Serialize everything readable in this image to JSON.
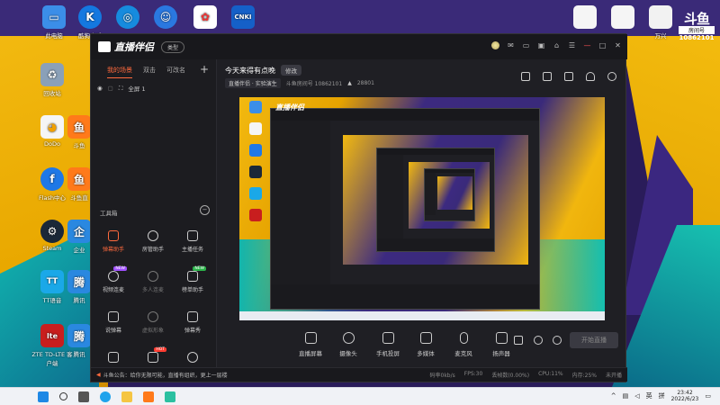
{
  "desktop": {
    "icons": [
      {
        "label": "此电脑",
        "color": "#3b8ee8",
        "glyph": "▭"
      },
      {
        "label": "酷狗音乐",
        "color": "#1478e0",
        "glyph": "K"
      },
      {
        "label": "",
        "color": "#168bde",
        "glyph": "◎"
      },
      {
        "label": "",
        "color": "#2a78e0",
        "glyph": "☺"
      },
      {
        "label": "",
        "color": "#ffffff",
        "glyph": "✿"
      },
      {
        "label": "CNKI",
        "color": "#1560c8",
        "glyph": "C"
      },
      {
        "label": "回收站",
        "color": "#8aa0b8",
        "glyph": "🗑"
      },
      {
        "label": "DoDo",
        "color": "#f5f5f5",
        "glyph": "🐥"
      },
      {
        "label": "斗鱼",
        "color": "#ff7a1a",
        "glyph": "鱼"
      },
      {
        "label": "Flash中心",
        "color": "#e03020",
        "glyph": "f"
      },
      {
        "label": "斗鱼直",
        "color": "#ff7a1a",
        "glyph": "鱼"
      },
      {
        "label": "Steam",
        "color": "#1b2838",
        "glyph": "⚙"
      },
      {
        "label": "企业",
        "color": "#2a88e0",
        "glyph": "企"
      },
      {
        "label": "TT语音",
        "color": "#1aa8e8",
        "glyph": "TT"
      },
      {
        "label": "腾讯",
        "color": "#2a88e0",
        "glyph": "腾"
      },
      {
        "label": "ZTE TD-LTE 客户端",
        "color": "#c81e1e",
        "glyph": "lte"
      },
      {
        "label": "腾讯",
        "color": "#2a88e0",
        "glyph": "腾"
      },
      {
        "label": "万兴",
        "color": "#f2f2f2",
        "glyph": "▯"
      }
    ],
    "brand": {
      "line1": "斗鱼",
      "line2": "房间号",
      "line3": "10862101"
    }
  },
  "app": {
    "name": "直播伴侣",
    "type_badge": "类型",
    "scene_tabs": [
      {
        "label": "我的场景",
        "active": true
      },
      {
        "label": "双击",
        "active": false
      },
      {
        "label": "可改名",
        "active": false
      }
    ],
    "scene_item": "全屏 1",
    "toolbox_label": "工具箱",
    "tools": [
      {
        "label": "弹幕助手",
        "state": "orange",
        "tag": ""
      },
      {
        "label": "房管助手",
        "state": "normal",
        "tag": ""
      },
      {
        "label": "主播任务",
        "state": "normal",
        "tag": ""
      },
      {
        "label": "视频连麦",
        "state": "normal",
        "tag": "NEW"
      },
      {
        "label": "多人连麦",
        "state": "dim",
        "tag": ""
      },
      {
        "label": "榜单助手",
        "state": "normal",
        "tag": "NEW"
      },
      {
        "label": "说弹幕",
        "state": "normal",
        "tag": ""
      },
      {
        "label": "虚拟形象",
        "state": "dim",
        "tag": ""
      },
      {
        "label": "弹幕秀",
        "state": "normal",
        "tag": ""
      },
      {
        "label": "",
        "state": "normal",
        "tag": ""
      },
      {
        "label": "",
        "state": "normal",
        "tag": "HOT"
      },
      {
        "label": "",
        "state": "normal",
        "tag": ""
      }
    ],
    "room": {
      "title": "今天来得有点晚",
      "edit_label": "修改",
      "category": "直播伴侣 · 实验演生",
      "room_no": "斗鱼房间号 10862101",
      "heat": "28801"
    },
    "controls": [
      {
        "label": "直播屏幕"
      },
      {
        "label": "摄像头"
      },
      {
        "label": "手机投屏"
      },
      {
        "label": "多媒体"
      },
      {
        "label": "麦克风"
      },
      {
        "label": "扬声器"
      }
    ],
    "start_button": "开始直播",
    "status": {
      "notice": "斗鱼公告：给你无限可能，直播有组织，更上一层楼",
      "bitrate": "码率0kb/s",
      "fps": "FPS:30",
      "drop": "丢帧数(0.00%)",
      "cpu": "CPU:11%",
      "mem": "内存:25%",
      "live": "未开播"
    }
  },
  "taskbar": {
    "lang": "英",
    "ime": "拼",
    "time": "23:42",
    "date": "2022/6/23"
  },
  "colors": {
    "accent": "#ff6a3d",
    "bg": "#1f1f24"
  }
}
